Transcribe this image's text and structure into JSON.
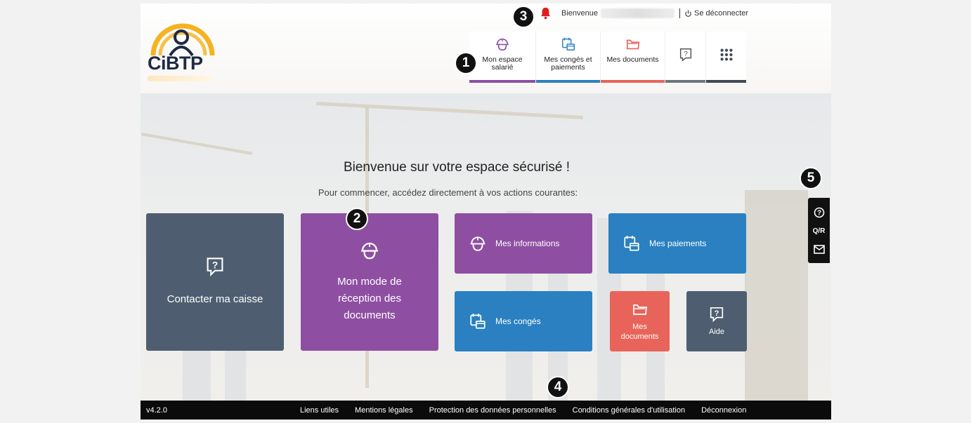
{
  "header": {
    "logo_text": "CiBTP",
    "welcome": "Bienvenue",
    "logout": "Se déconnecter"
  },
  "nav": [
    {
      "label_line1": "Mon espace",
      "label_line2": "salarié",
      "color": "#8e4fa3",
      "icon": "hard-hat-icon"
    },
    {
      "label_line1": "Mes congés et",
      "label_line2": "paiements",
      "color": "#2a80c0",
      "icon": "calendar-money-icon"
    },
    {
      "label_line1": "Mes documents",
      "label_line2": "",
      "color": "#e8645a",
      "icon": "folder-icon"
    },
    {
      "label_line1": "",
      "label_line2": "",
      "color": "#6b7680",
      "icon": "help-bubble-icon"
    },
    {
      "label_line1": "",
      "label_line2": "",
      "color": "#3f4a55",
      "icon": "apps-grid-icon"
    }
  ],
  "hero": {
    "title": "Bienvenue sur votre espace sécurisé !",
    "subtitle": "Pour commencer, accédez directement à vos actions courantes:"
  },
  "tiles": {
    "contact": "Contacter ma caisse",
    "mode_line1": "Mon mode de",
    "mode_line2": "réception des",
    "mode_line3": "documents",
    "informations": "Mes informations",
    "paiements": "Mes paiements",
    "conges": "Mes congés",
    "documents_line1": "Mes",
    "documents_line2": "documents",
    "aide": "Aide"
  },
  "sidebar": {
    "qr": "Q/R"
  },
  "footer": {
    "version": "v4.2.0",
    "links": [
      "Liens utiles",
      "Mentions légales",
      "Protection des données personnelles",
      "Conditions générales d'utilisation",
      "Déconnexion"
    ]
  },
  "callouts": [
    "1",
    "2",
    "3",
    "4",
    "5"
  ],
  "colors": {
    "purple": "#8e4fa3",
    "blue": "#2a80c0",
    "coral": "#e8645a",
    "slate": "#4e5e70",
    "bell": "#e01e1e"
  }
}
